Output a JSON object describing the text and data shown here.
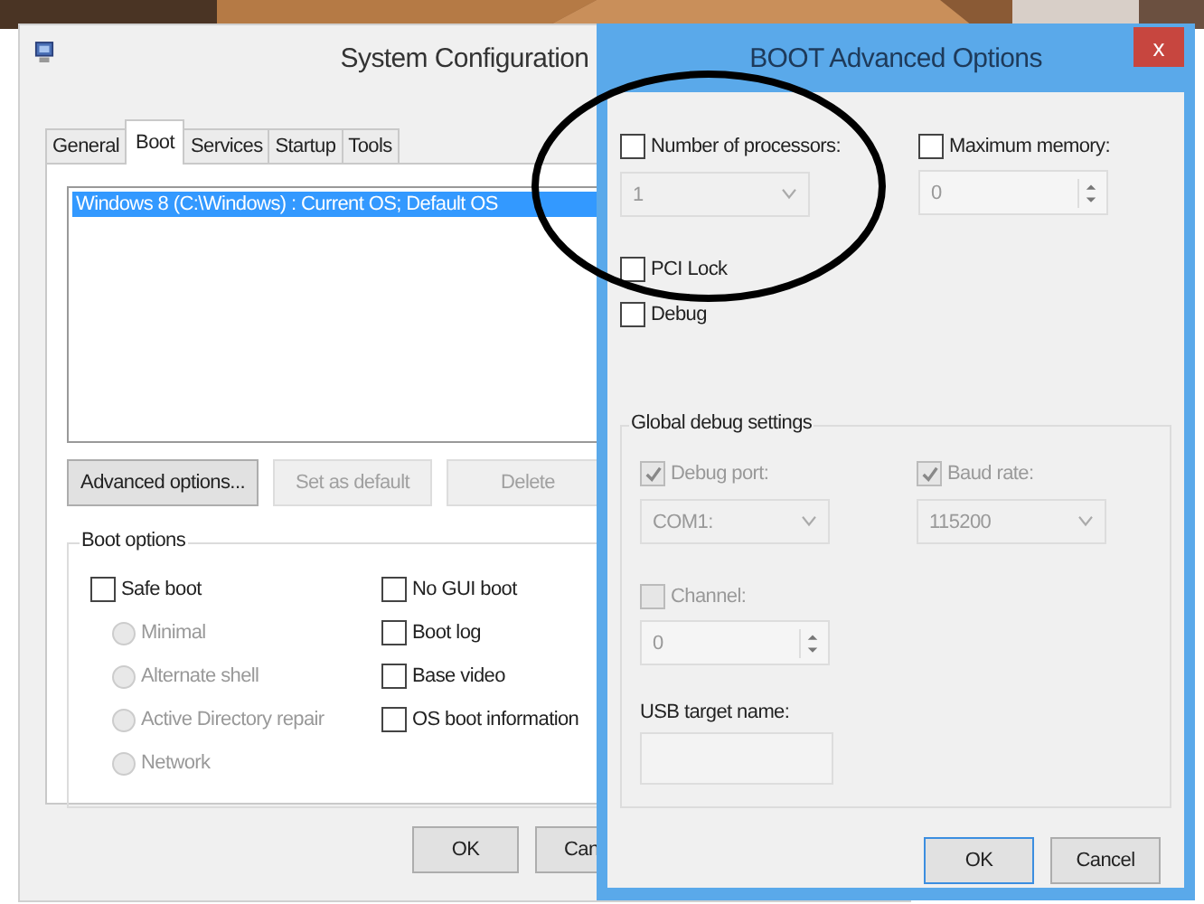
{
  "main_window": {
    "title": "System Configuration",
    "tabs": [
      {
        "label": "General",
        "selected": false
      },
      {
        "label": "Boot",
        "selected": true
      },
      {
        "label": "Services",
        "selected": false
      },
      {
        "label": "Startup",
        "selected": false
      },
      {
        "label": "Tools",
        "selected": false
      }
    ],
    "boot_list": [
      {
        "text": "Windows 8 (C:\\Windows) : Current OS; Default OS",
        "selected": true
      }
    ],
    "buttons": [
      {
        "label": "Advanced options...",
        "disabled": false
      },
      {
        "label": "Set as default",
        "disabled": true
      },
      {
        "label": "Delete",
        "disabled": true
      }
    ],
    "boot_options": {
      "title": "Boot options",
      "safe_boot": {
        "label": "Safe boot",
        "checked": false
      },
      "modes": [
        {
          "label": "Minimal",
          "selected": false,
          "disabled": true
        },
        {
          "label": "Alternate shell",
          "selected": false,
          "disabled": true
        },
        {
          "label": "Active Directory repair",
          "selected": false,
          "disabled": true
        },
        {
          "label": "Network",
          "selected": false,
          "disabled": true
        }
      ],
      "flags": [
        {
          "label": "No GUI boot",
          "checked": false
        },
        {
          "label": "Boot log",
          "checked": false
        },
        {
          "label": "Base video",
          "checked": false
        },
        {
          "label": "OS boot information",
          "checked": false
        }
      ]
    },
    "footer_buttons": [
      "OK",
      "Can"
    ]
  },
  "dialog": {
    "title": "BOOT Advanced Options",
    "close": "x",
    "processors": {
      "label": "Number of processors:",
      "checked": false,
      "value": "1"
    },
    "max_memory": {
      "label": "Maximum memory:",
      "checked": false,
      "value": "0"
    },
    "options": [
      {
        "label": "PCI Lock",
        "checked": false
      },
      {
        "label": "Debug",
        "checked": false
      }
    ],
    "debug_group": {
      "title": "Global debug settings",
      "debug_port": {
        "label": "Debug port:",
        "checked": true,
        "disabled": true,
        "value": "COM1:"
      },
      "baud_rate": {
        "label": "Baud rate:",
        "checked": true,
        "disabled": true,
        "value": "115200"
      },
      "channel": {
        "label": "Channel:",
        "checked": false,
        "disabled": true,
        "value": "0"
      },
      "usb_target": {
        "label": "USB target name:"
      }
    },
    "buttons": [
      {
        "label": "OK",
        "default": true
      },
      {
        "label": "Cancel",
        "default": false
      }
    ]
  }
}
